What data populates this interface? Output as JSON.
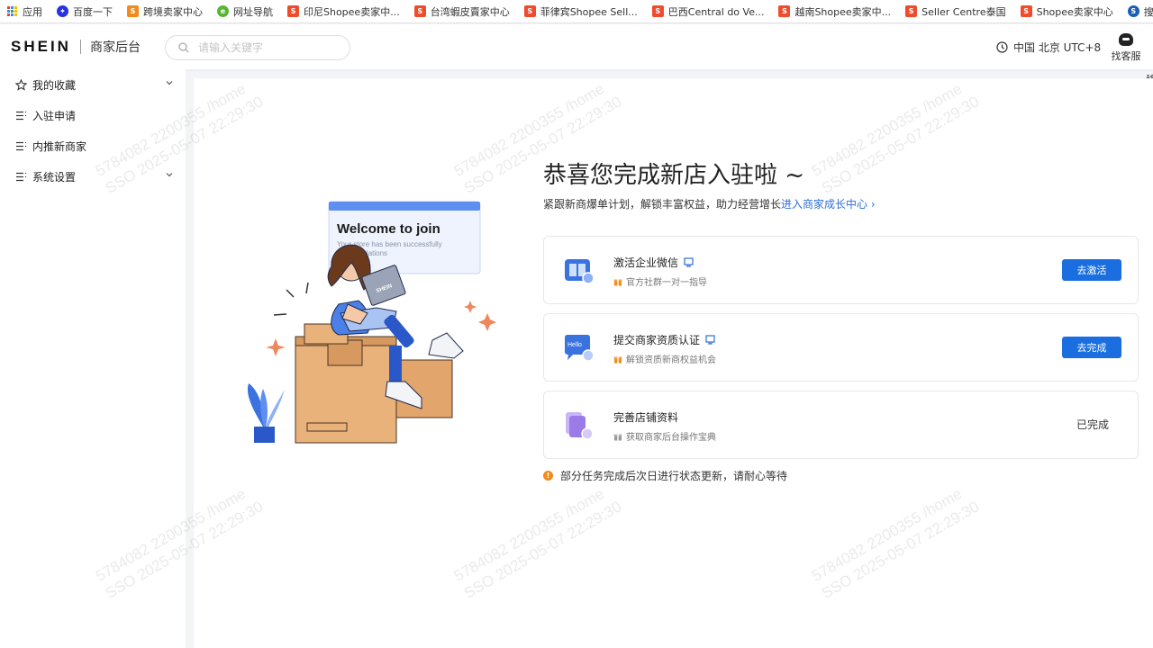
{
  "bookmarks": [
    {
      "label": "应用",
      "icon": "apps-grid-icon"
    },
    {
      "label": "百度一下",
      "icon": "baidu-paw-icon",
      "color": "#2932e1"
    },
    {
      "label": "跨境卖家中心",
      "icon": "shein-cross-border-icon",
      "color": "#f28b1c"
    },
    {
      "label": "网址导航",
      "icon": "nav-globe-icon",
      "color": "#5bb535"
    },
    {
      "label": "印尼Shopee卖家中...",
      "icon": "shopee-bag-icon",
      "color": "#ee4d2d"
    },
    {
      "label": "台湾蝦皮賣家中心",
      "icon": "shopee-bag-icon",
      "color": "#ee4d2d"
    },
    {
      "label": "菲律宾Shopee Sell...",
      "icon": "shopee-bag-icon",
      "color": "#ee4d2d"
    },
    {
      "label": "巴西Central do Ve...",
      "icon": "shopee-bag-icon",
      "color": "#ee4d2d"
    },
    {
      "label": "越南Shopee卖家中...",
      "icon": "shopee-bag-icon",
      "color": "#ee4d2d"
    },
    {
      "label": "Seller Centre泰国",
      "icon": "shopee-bag-icon",
      "color": "#ee4d2d"
    },
    {
      "label": "Shopee卖家中心",
      "icon": "shopee-bag-icon",
      "color": "#ee4d2d"
    },
    {
      "label": "搜狗网址导航 -",
      "icon": "sogou-icon",
      "color": "#1a5fb4"
    }
  ],
  "header": {
    "brand": "SHEIN",
    "subtitle": "商家后台",
    "search_placeholder": "请输入关键字",
    "timezone": "中国 北京 UTC+8",
    "service_label": "找客服",
    "edge_label": "移"
  },
  "sidebar": {
    "items": [
      {
        "label": "我的收藏",
        "icon": "star-icon",
        "expandable": true
      },
      {
        "label": "入驻申请",
        "icon": "list-icon",
        "expandable": false
      },
      {
        "label": "内推新商家",
        "icon": "list-icon",
        "expandable": false
      },
      {
        "label": "系统设置",
        "icon": "list-icon",
        "expandable": true
      }
    ]
  },
  "main": {
    "title": "恭喜您完成新店入驻啦 ~",
    "subtitle_text": "紧跟新商爆单计划，解锁丰富权益，助力经营增长",
    "subtitle_link": "进入商家成长中心 ›",
    "illustration": {
      "card_title": "Welcome to join",
      "card_line1": "Your store has been successfully",
      "card_line2": "Congratulations",
      "laptop_brand": "SHEIN"
    },
    "tasks": [
      {
        "title": "激活企业微信",
        "subtitle": "官方社群一对一指导",
        "action": "去激活",
        "status": "pending",
        "icon": "wechat-book-icon"
      },
      {
        "title": "提交商家资质认证",
        "subtitle": "解锁资质新商权益机会",
        "action": "去完成",
        "status": "pending",
        "icon": "hello-chat-icon"
      },
      {
        "title": "完善店铺资料",
        "subtitle": "获取商家后台操作宝典",
        "action": "已完成",
        "status": "done",
        "icon": "store-docs-icon"
      }
    ],
    "notice": "部分任务完成后次日进行状态更新，请耐心等待"
  },
  "watermark": {
    "line1": "5784082 2200355 /home",
    "line2": "SSO 2025-05-07 22:29:30"
  },
  "colors": {
    "primary": "#1a6ee0",
    "link": "#2d6fd6",
    "warn": "#f08c1e",
    "gift": "#f08c1e"
  }
}
